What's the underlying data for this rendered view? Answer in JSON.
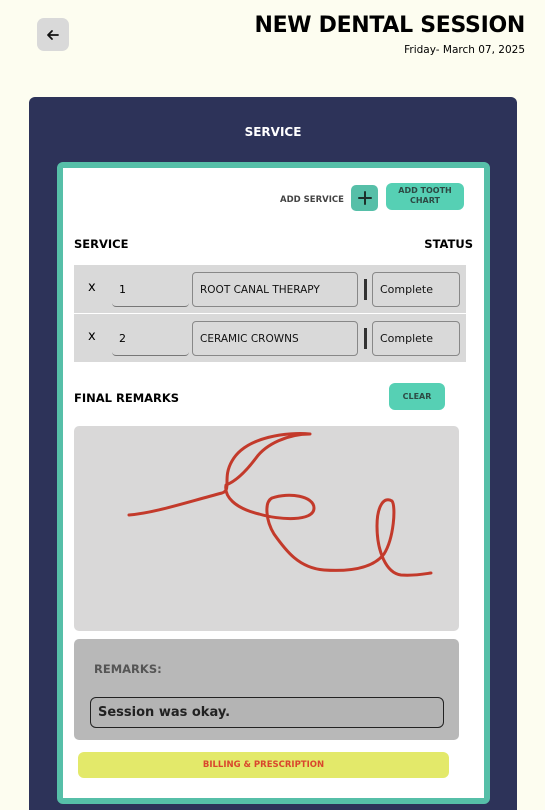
{
  "header": {
    "title": "NEW DENTAL SESSION",
    "date": "Friday- March 07, 2025"
  },
  "panel": {
    "title": "SERVICE"
  },
  "toolbar": {
    "add_service_label": "ADD SERVICE",
    "add_tooth_chart_label": "ADD TOOTH CHART"
  },
  "table": {
    "service_header": "SERVICE",
    "status_header": "STATUS",
    "rows": [
      {
        "remove": "x",
        "quantity": "1",
        "service": "ROOT CANAL THERAPY",
        "status": "Complete"
      },
      {
        "remove": "x",
        "quantity": "2",
        "service": "CERAMIC CROWNS",
        "status": "Complete"
      }
    ]
  },
  "final_remarks": {
    "title": "FINAL REMARKS",
    "clear_label": "CLEAR"
  },
  "remarks": {
    "label": "REMARKS:",
    "value": "Session was okay."
  },
  "billing": {
    "label": "BILLING & PRESCRIPTION"
  },
  "colors": {
    "background": "#fdfdf0",
    "panel": "#2d3359",
    "accent": "#56bfa8",
    "signature_stroke": "#c33a2b",
    "billing_button": "#e3e96a",
    "billing_text": "#d9462d"
  },
  "icons": {
    "back": "arrow-left-icon",
    "add": "plus-icon"
  }
}
